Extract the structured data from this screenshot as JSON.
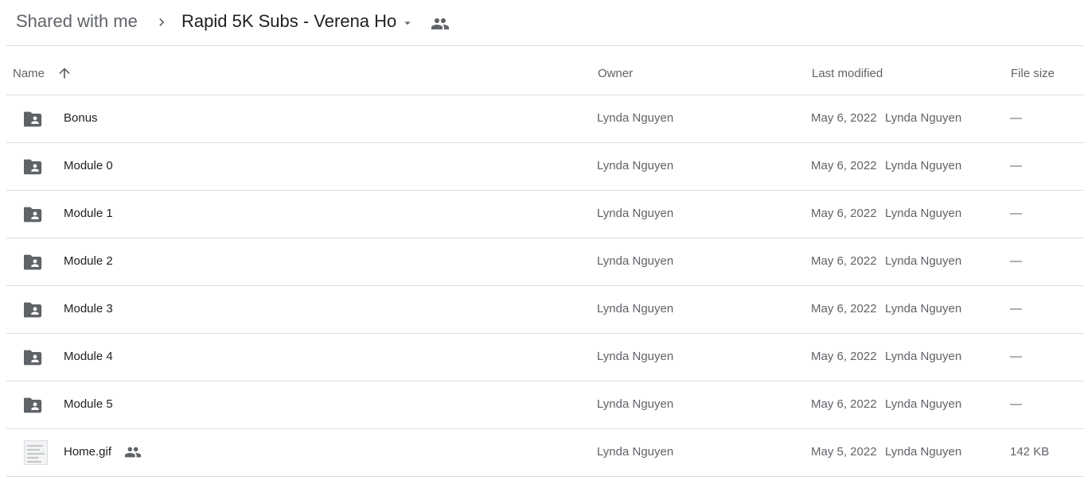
{
  "breadcrumb": {
    "root": "Shared with me",
    "current": "Rapid 5K Subs - Verena Ho"
  },
  "columns": {
    "name": "Name",
    "owner": "Owner",
    "last_modified": "Last modified",
    "file_size": "File size"
  },
  "rows": [
    {
      "name": "Bonus",
      "type": "folder",
      "owner": "Lynda Nguyen",
      "date": "May 6, 2022",
      "modifier": "Lynda Nguyen",
      "size": "—"
    },
    {
      "name": "Module 0",
      "type": "folder",
      "owner": "Lynda Nguyen",
      "date": "May 6, 2022",
      "modifier": "Lynda Nguyen",
      "size": "—"
    },
    {
      "name": "Module 1",
      "type": "folder",
      "owner": "Lynda Nguyen",
      "date": "May 6, 2022",
      "modifier": "Lynda Nguyen",
      "size": "—"
    },
    {
      "name": "Module 2",
      "type": "folder",
      "owner": "Lynda Nguyen",
      "date": "May 6, 2022",
      "modifier": "Lynda Nguyen",
      "size": "—"
    },
    {
      "name": "Module 3",
      "type": "folder",
      "owner": "Lynda Nguyen",
      "date": "May 6, 2022",
      "modifier": "Lynda Nguyen",
      "size": "—"
    },
    {
      "name": "Module 4",
      "type": "folder",
      "owner": "Lynda Nguyen",
      "date": "May 6, 2022",
      "modifier": "Lynda Nguyen",
      "size": "—"
    },
    {
      "name": "Module 5",
      "type": "folder",
      "owner": "Lynda Nguyen",
      "date": "May 6, 2022",
      "modifier": "Lynda Nguyen",
      "size": "—"
    },
    {
      "name": "Home.gif",
      "type": "image",
      "shared": true,
      "owner": "Lynda Nguyen",
      "date": "May 5, 2022",
      "modifier": "Lynda Nguyen",
      "size": "142 KB"
    }
  ],
  "icons": {
    "breadcrumb_separator": "chevron-right-icon",
    "dropdown": "arrow-drop-down-icon",
    "shared": "people-icon",
    "sort": "arrow-upward-icon",
    "folder": "shared-folder-icon"
  },
  "colors": {
    "icon": "#5f6368",
    "divider": "#dadce0",
    "text_primary": "#202124",
    "text_secondary": "#5f6368"
  }
}
